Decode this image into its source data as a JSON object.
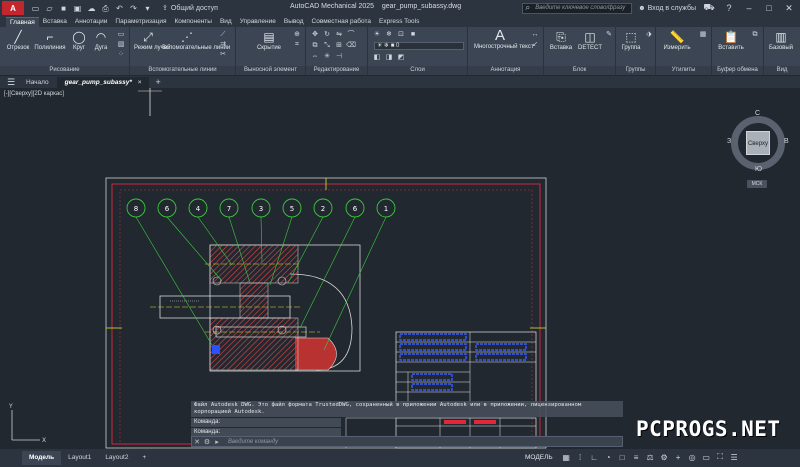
{
  "titlebar": {
    "app_logo": "A",
    "share_label": "Общий доступ",
    "app_title": "AutoCAD Mechanical 2025",
    "file_name": "gear_pump_subassy.dwg",
    "search_placeholder": "Введите ключевое слово/фразу",
    "login_label": "Вход в службы"
  },
  "ribbon_tabs": [
    "Главная",
    "Вставка",
    "Аннотации",
    "Параметризация",
    "Компоненты",
    "Вид",
    "Управление",
    "Вывод",
    "Совместная работа",
    "Express Tools"
  ],
  "ribbon": {
    "draw": {
      "title": "Рисование",
      "line": "Отрезок",
      "polyline": "Полилиния",
      "circle": "Круг",
      "arc": "Дуга"
    },
    "construction": {
      "title": "Вспомогательные линии",
      "ray_modes": "Режим лучей",
      "aux_lines": "Вспомогательные линии"
    },
    "callout": {
      "title": "Выносной элемент",
      "hide": "Скрытие"
    },
    "modify": {
      "title": "Редактирование"
    },
    "layers": {
      "title": "Слои",
      "current_layer": "0"
    },
    "annotation": {
      "title": "Аннотация",
      "mtext": "Многострочный текст"
    },
    "block": {
      "title": "Блок",
      "insert": "Вставка",
      "detect": "DETECT"
    },
    "groups": {
      "title": "Группы",
      "group": "Группа"
    },
    "utilities": {
      "title": "Утилиты",
      "measure": "Измерить"
    },
    "clipboard": {
      "title": "Буфер обмена",
      "paste": "Вставить"
    },
    "view": {
      "title": "Вид",
      "base": "Базовый"
    }
  },
  "file_tabs": {
    "start": "Начало",
    "active": "gear_pump_subassy*",
    "close": "×",
    "plus": "+"
  },
  "viewport_label": "[-][Сверху][2D каркас]",
  "viewcube": {
    "north": "С",
    "south": "Ю",
    "west": "З",
    "east": "В",
    "face": "Сверху",
    "wcs": "МСК"
  },
  "balloons": [
    "8",
    "6",
    "4",
    "7",
    "3",
    "5",
    "2",
    "6",
    "1"
  ],
  "command": {
    "history": "Файл Autodesk DWG. Это файл формата TrustedDWG, сохраненный в приложении Autodesk или в приложении, лицензированном корпорацией Autodesk.",
    "line1": "Команда:",
    "line2": "Команда:",
    "placeholder": "Введите команду"
  },
  "watermark": "PCPROGS.NET",
  "statusbar": {
    "tabs": [
      "Модель",
      "Layout1",
      "Layout2"
    ],
    "add": "+",
    "model_label": "МОДЕЛЬ"
  },
  "colors": {
    "background": "#212830",
    "frame_red": "#e0283a",
    "balloon_green": "#3ccc3c",
    "hatch_red": "#d23b3b",
    "text_blue": "#3a5cff"
  }
}
